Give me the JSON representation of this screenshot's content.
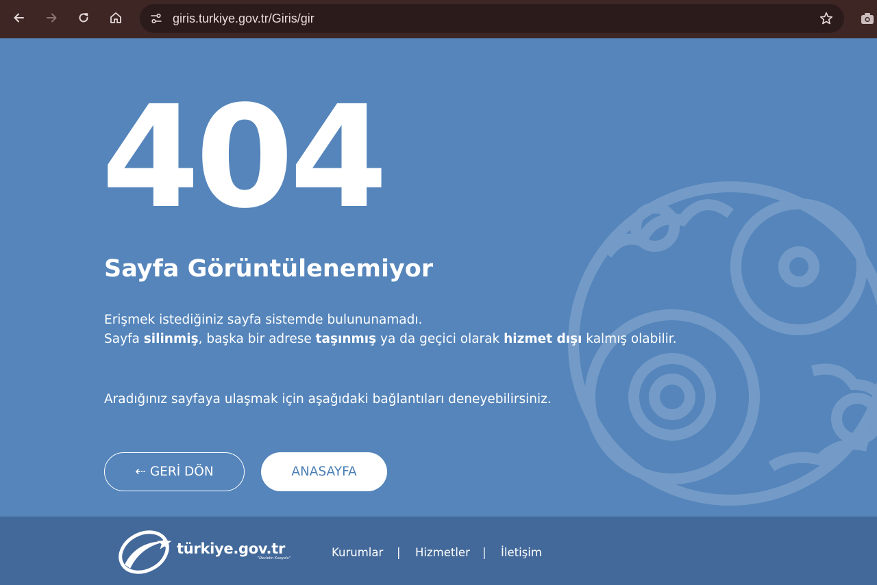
{
  "browser": {
    "url": "giris.turkiye.gov.tr/Giris/gir"
  },
  "error": {
    "code": "404",
    "title": "Sayfa Görüntülenemiyor",
    "line1": "Erişmek istediğiniz sayfa sistemde bulununamadı.",
    "line2_a": "Sayfa ",
    "line2_b": "silinmiş",
    "line2_c": ", başka bir adrese ",
    "line2_d": "taşınmış",
    "line2_e": " ya da geçici olarak ",
    "line2_f": "hizmet dışı",
    "line2_g": " kalmış olabilir.",
    "hint": "Aradığınız sayfaya ulaşmak için aşağıdaki bağlantıları deneyebilirsiniz."
  },
  "buttons": {
    "back_arrow": "⇠",
    "back_label": "GERİ DÖN",
    "home_label": "ANASAYFA"
  },
  "footer": {
    "logo_text": "türkiye.gov.tr",
    "logo_tagline": "\"Devletin Kısayolu\"",
    "links": [
      "Kurumlar",
      "Hizmetler",
      "İletişim"
    ],
    "separator": "|"
  },
  "colors": {
    "chrome_bg": "#3d2624",
    "omnibox_bg": "#2b1b1a",
    "main_bg": "#5585bb",
    "footer_bg": "#43699a",
    "button_text": "#4b7fb5"
  },
  "icons": {
    "back": "arrow-left-icon",
    "forward": "arrow-right-icon",
    "reload": "reload-icon",
    "home": "home-icon",
    "site_info": "tune-icon",
    "bookmark": "star-icon",
    "extension": "camera-icon"
  }
}
